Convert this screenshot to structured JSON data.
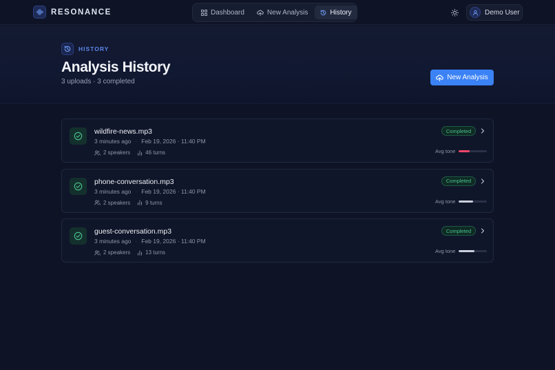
{
  "brand": {
    "name": "RESONANCE",
    "icon": "waveform-icon"
  },
  "nav": {
    "items": [
      {
        "label": "Dashboard",
        "icon": "grid-icon",
        "active": false
      },
      {
        "label": "New Analysis",
        "icon": "cloud-upload-icon",
        "active": false
      },
      {
        "label": "History",
        "icon": "history-icon",
        "active": true
      }
    ]
  },
  "header": {
    "theme_icon": "sun-icon",
    "user_name": "Demo User",
    "user_icon": "user-icon"
  },
  "page": {
    "eyebrow": "HISTORY",
    "title": "Analysis History",
    "subtitle": "3 uploads · 3 completed",
    "cta_label": "New Analysis"
  },
  "colors": {
    "accent": "#3b82f6",
    "success": "#49c48f",
    "tone_negative": "#f0476a",
    "tone_neutral": "#c9cfdc",
    "background": "#0e1326"
  },
  "tone_label": "Avg tone",
  "analyses": [
    {
      "file": "wildfire-news.mp3",
      "relative_time": "3 minutes ago",
      "timestamp": "Feb 19, 2026 · 11:40 PM",
      "speakers": "2 speakers",
      "turns": "46 turns",
      "status": "Completed",
      "avg_tone": 0.38,
      "tone_color": "#f0476a"
    },
    {
      "file": "phone-conversation.mp3",
      "relative_time": "3 minutes ago",
      "timestamp": "Feb 19, 2026 · 11:40 PM",
      "speakers": "2 speakers",
      "turns": "9 turns",
      "status": "Completed",
      "avg_tone": 0.5,
      "tone_color": "#c9cfdc"
    },
    {
      "file": "guest-conversation.mp3",
      "relative_time": "3 minutes ago",
      "timestamp": "Feb 19, 2026 · 11:40 PM",
      "speakers": "2 speakers",
      "turns": "13 turns",
      "status": "Completed",
      "avg_tone": 0.55,
      "tone_color": "#c9cfdc"
    }
  ]
}
